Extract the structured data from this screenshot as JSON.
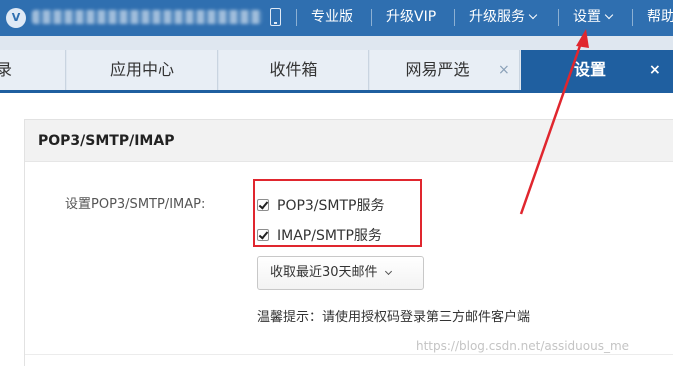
{
  "topbar": {
    "logo_letter": "V",
    "nav": {
      "pro": "专业版",
      "vip": "升级VIP",
      "upgrade_service": "升级服务",
      "settings": "设置",
      "help": "帮助"
    }
  },
  "tabs": [
    {
      "label": "录"
    },
    {
      "label": "应用中心"
    },
    {
      "label": "收件箱"
    },
    {
      "label": "网易严选",
      "close": "×"
    },
    {
      "label": "设置",
      "close": "×"
    }
  ],
  "panel": {
    "title": "POP3/SMTP/IMAP",
    "row_label": "设置POP3/SMTP/IMAP:",
    "checkboxes": [
      {
        "label": "POP3/SMTP服务",
        "checked": true
      },
      {
        "label": "IMAP/SMTP服务",
        "checked": true
      }
    ],
    "select_value": "收取最近30天邮件",
    "tip": "温馨提示：请使用授权码登录第三方邮件客户端"
  },
  "watermark": "https://blog.csdn.net/assiduous_me",
  "colors": {
    "topbar": "#2f6fb0",
    "active_tab": "#1f5fa0",
    "annotation": "#e0262e"
  },
  "icons": [
    "logo-icon",
    "phone-icon",
    "chevron-down-icon",
    "close-icon",
    "checkbox-checked-icon",
    "annotation-arrow"
  ]
}
